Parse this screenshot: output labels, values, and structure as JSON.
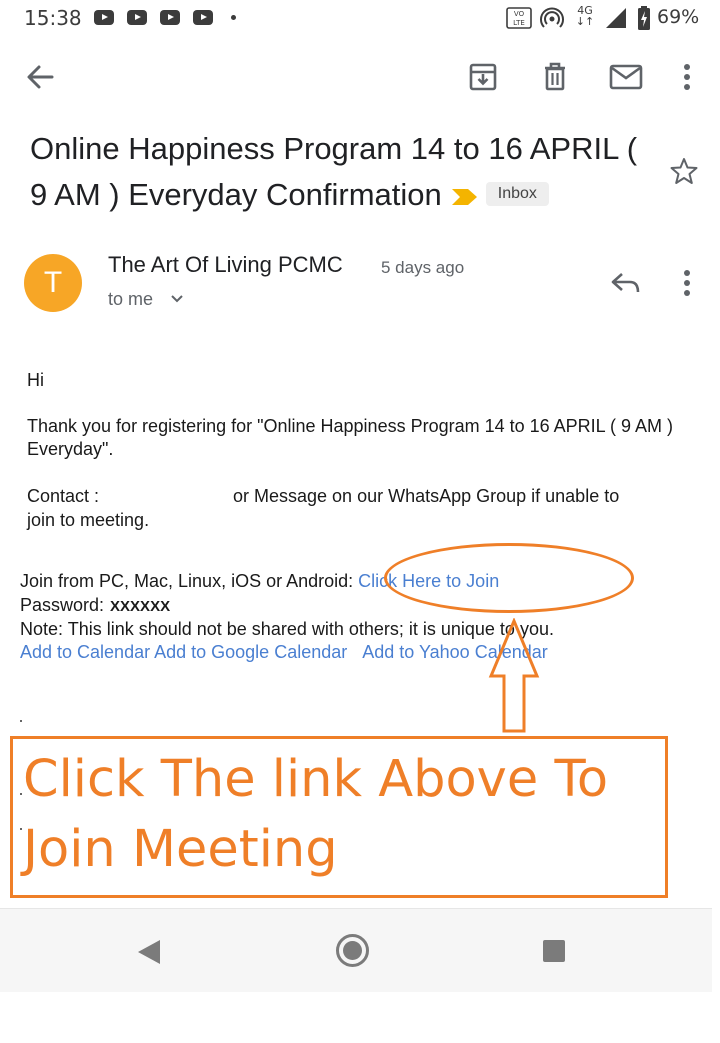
{
  "status_bar": {
    "time": "15:38",
    "network": "4G",
    "battery": "69%",
    "icons": [
      "youtube-icon",
      "youtube-icon",
      "youtube-icon",
      "youtube-icon",
      "notification-dot",
      "volte-icon",
      "hotspot-icon",
      "4g-data-icon",
      "signal-icon",
      "battery-icon"
    ]
  },
  "toolbar": {
    "icons": [
      "back-arrow-icon",
      "archive-icon",
      "delete-icon",
      "mark-unread-icon",
      "more-vert-icon"
    ]
  },
  "email": {
    "subject": "Online Happiness Program 14 to 16 APRIL ( 9 AM ) Everyday Confirmation",
    "label": "Inbox",
    "sender": {
      "initial": "T",
      "name": "The Art Of Living PCMC",
      "time": "5 days ago",
      "recipient": "to me",
      "avatar_color": "#f7a626"
    },
    "body": {
      "greeting": "Hi",
      "thanks": "Thank you for registering for \"Online Happiness Program 14 to 16 APRIL ( 9 AM ) Everyday\".",
      "contact_label": "Contact :",
      "contact_rest": "or Message on our WhatsApp Group if unable to join to meeting.",
      "join_text": "Join from PC, Mac, Linux, iOS or Android:",
      "join_link": "Click Here to Join",
      "password_label": "Password:",
      "password_value": "XXXXXX",
      "note": "Note: This link should not be shared with others; it is unique to you.",
      "calendar_links": [
        "Add to Calendar",
        "Add to Google Calendar",
        "Add to Yahoo Calendar"
      ]
    }
  },
  "annotation": {
    "text_line1": "Click The link Above To",
    "text_line2": "Join Meeting",
    "color": "#ef7f28"
  },
  "colors": {
    "link": "#4a7fd1",
    "icon_gray": "#5f6368"
  }
}
